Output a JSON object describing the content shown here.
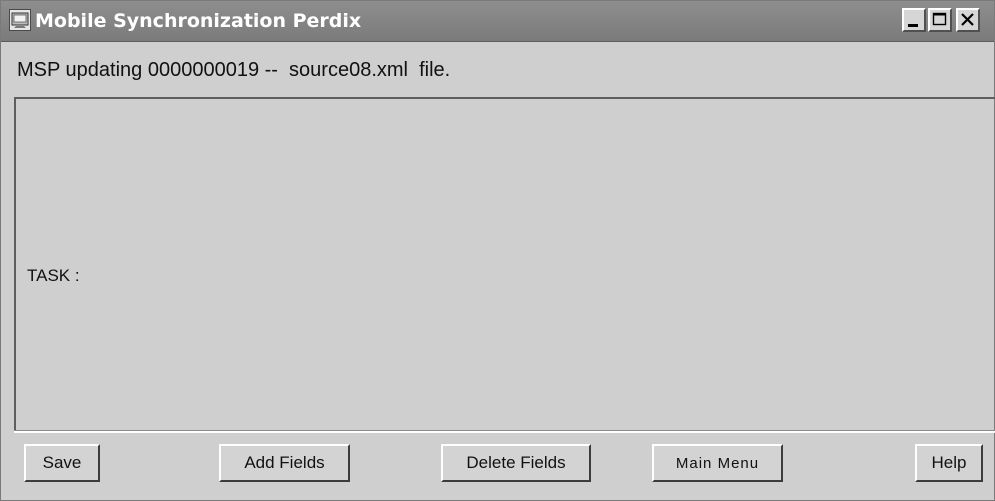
{
  "window": {
    "title": "Mobile Synchronization Perdix",
    "controls": [
      "minimize",
      "maximize",
      "close"
    ]
  },
  "status": {
    "message": "MSP updating 0000000019 --  source08.xml  file."
  },
  "panel": {
    "task_label": "TASK :"
  },
  "buttons": {
    "save": "Save",
    "add_fields": "Add Fields",
    "delete_fields": "Delete Fields",
    "main_menu": "Main Menu",
    "help": "Help"
  },
  "colors": {
    "title_bar": "#7f7f7f",
    "background": "#cfcfcf"
  },
  "icons": {
    "app": "app-window-icon",
    "minimize": "minimize-icon",
    "maximize": "maximize-icon",
    "close": "close-icon"
  }
}
